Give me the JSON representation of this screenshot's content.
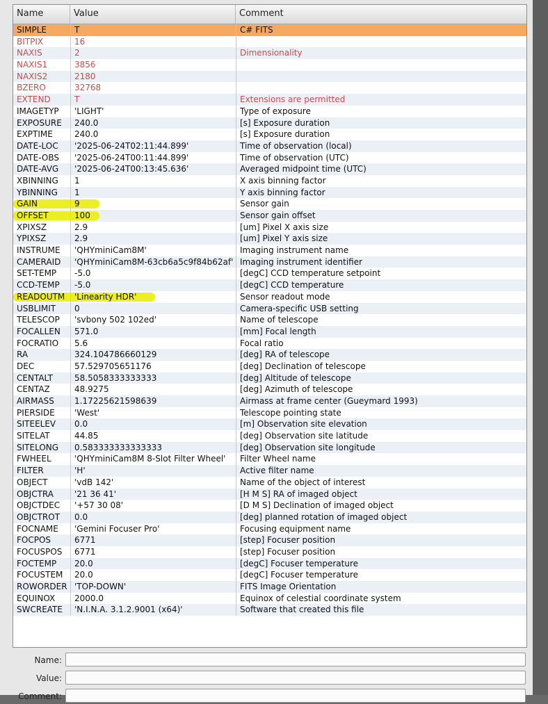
{
  "columns": [
    "Name",
    "Value",
    "Comment"
  ],
  "rows": [
    [
      "SIMPLE",
      "T",
      "C# FITS"
    ],
    [
      "BITPIX",
      "16",
      ""
    ],
    [
      "NAXIS",
      "2",
      "Dimensionality"
    ],
    [
      "NAXIS1",
      "3856",
      ""
    ],
    [
      "NAXIS2",
      "2180",
      ""
    ],
    [
      "BZERO",
      "32768",
      ""
    ],
    [
      "EXTEND",
      "T",
      "Extensions are permitted"
    ],
    [
      "IMAGETYP",
      "'LIGHT'",
      "Type of exposure"
    ],
    [
      "EXPOSURE",
      "240.0",
      "[s] Exposure duration"
    ],
    [
      "EXPTIME",
      "240.0",
      "[s] Exposure duration"
    ],
    [
      "DATE-LOC",
      "'2025-06-24T02:11:44.899'",
      "Time of observation (local)"
    ],
    [
      "DATE-OBS",
      "'2025-06-24T00:11:44.899'",
      "Time of observation (UTC)"
    ],
    [
      "DATE-AVG",
      "'2025-06-24T00:13:45.636'",
      "Averaged midpoint time (UTC)"
    ],
    [
      "XBINNING",
      "1",
      "X axis binning factor"
    ],
    [
      "YBINNING",
      "1",
      "Y axis binning factor"
    ],
    [
      "GAIN",
      "9",
      "Sensor gain"
    ],
    [
      "OFFSET",
      "100",
      "Sensor gain offset"
    ],
    [
      "XPIXSZ",
      "2.9",
      "[um] Pixel X axis size"
    ],
    [
      "YPIXSZ",
      "2.9",
      "[um] Pixel Y axis size"
    ],
    [
      "INSTRUME",
      "'QHYminiCam8M'",
      "Imaging instrument name"
    ],
    [
      "CAMERAID",
      "'QHYminiCam8M-63cb6a5c9f84b62af'",
      "Imaging instrument identifier"
    ],
    [
      "SET-TEMP",
      "-5.0",
      "[degC] CCD temperature setpoint"
    ],
    [
      "CCD-TEMP",
      "-5.0",
      "[degC] CCD temperature"
    ],
    [
      "READOUTM",
      "'Linearity HDR'",
      "Sensor readout mode"
    ],
    [
      "USBLIMIT",
      "0",
      "Camera-specific USB setting"
    ],
    [
      "TELESCOP",
      "'svbony 502 102ed'",
      "Name of telescope"
    ],
    [
      "FOCALLEN",
      "571.0",
      "[mm] Focal length"
    ],
    [
      "FOCRATIO",
      "5.6",
      "Focal ratio"
    ],
    [
      "RA",
      "324.104786660129",
      "[deg] RA of telescope"
    ],
    [
      "DEC",
      "57.529705651176",
      "[deg] Declination of telescope"
    ],
    [
      "CENTALT",
      "58.5058333333333",
      "[deg] Altitude of telescope"
    ],
    [
      "CENTAZ",
      "48.9275",
      "[deg] Azimuth of telescope"
    ],
    [
      "AIRMASS",
      "1.17225621598639",
      "Airmass at frame center (Gueymard 1993)"
    ],
    [
      "PIERSIDE",
      "'West'",
      "Telescope pointing state"
    ],
    [
      "SITEELEV",
      "0.0",
      "[m] Observation site elevation"
    ],
    [
      "SITELAT",
      "44.85",
      "[deg] Observation site latitude"
    ],
    [
      "SITELONG",
      "0.583333333333333",
      "[deg] Observation site longitude"
    ],
    [
      "FWHEEL",
      "'QHYminiCam8M 8-Slot Filter Wheel'",
      "Filter Wheel name"
    ],
    [
      "FILTER",
      "'H'",
      "Active filter name"
    ],
    [
      "OBJECT",
      "'vdB 142'",
      "Name of the object of interest"
    ],
    [
      "OBJCTRA",
      "'21 36 41'",
      "[H M S] RA of imaged object"
    ],
    [
      "OBJCTDEC",
      "'+57 30 08'",
      "[D M S] Declination of imaged object"
    ],
    [
      "OBJCTROT",
      "0.0",
      "[deg] planned rotation of imaged object"
    ],
    [
      "FOCNAME",
      "'Gemini Focuser Pro'",
      "Focusing equipment name"
    ],
    [
      "FOCPOS",
      "6771",
      "[step] Focuser position"
    ],
    [
      "FOCUSPOS",
      "6771",
      "[step] Focuser position"
    ],
    [
      "FOCTEMP",
      "20.0",
      "[degC] Focuser temperature"
    ],
    [
      "FOCUSTEM",
      "20.0",
      "[degC] Focuser temperature"
    ],
    [
      "ROWORDER",
      "'TOP-DOWN'",
      "FITS Image Orientation"
    ],
    [
      "EQUINOX",
      "2000.0",
      "Equinox of celestial coordinate system"
    ],
    [
      "SWCREATE",
      "'N.I.N.A. 3.1.2.9001 (x64)'",
      "Software that created this file"
    ]
  ],
  "selected_row": 0,
  "fixed_keyword_rows": [
    1,
    2,
    3,
    4,
    5,
    6
  ],
  "highlighted_rows": [
    15,
    16,
    23
  ],
  "colors": {
    "selected_row": "#f7a861",
    "fixed_keyword_text": "#c0504d",
    "highlighter": "#ecee12",
    "alt_row": "#ebeff6"
  },
  "form": {
    "name_label": "Name:",
    "value_label": "Value:",
    "comment_label": "Comment:",
    "name_value": "",
    "value_value": "",
    "comment_value": ""
  }
}
